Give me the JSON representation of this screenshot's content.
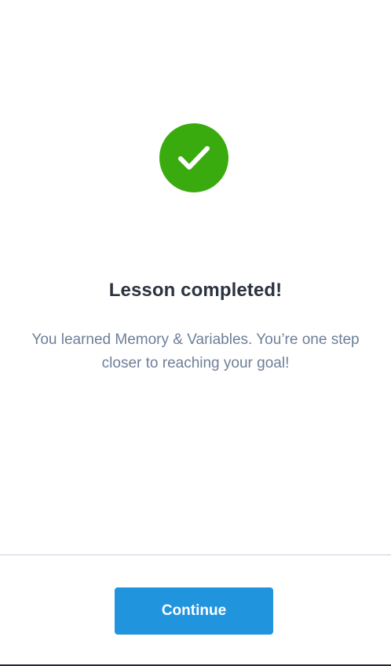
{
  "completion": {
    "icon": "checkmark-icon",
    "accent_color": "#3aab0f",
    "title": "Lesson completed!",
    "message": "You learned Memory & Variables. You’re one step closer to reaching your goal!"
  },
  "footer": {
    "continue_label": "Continue",
    "button_color": "#2194de"
  }
}
